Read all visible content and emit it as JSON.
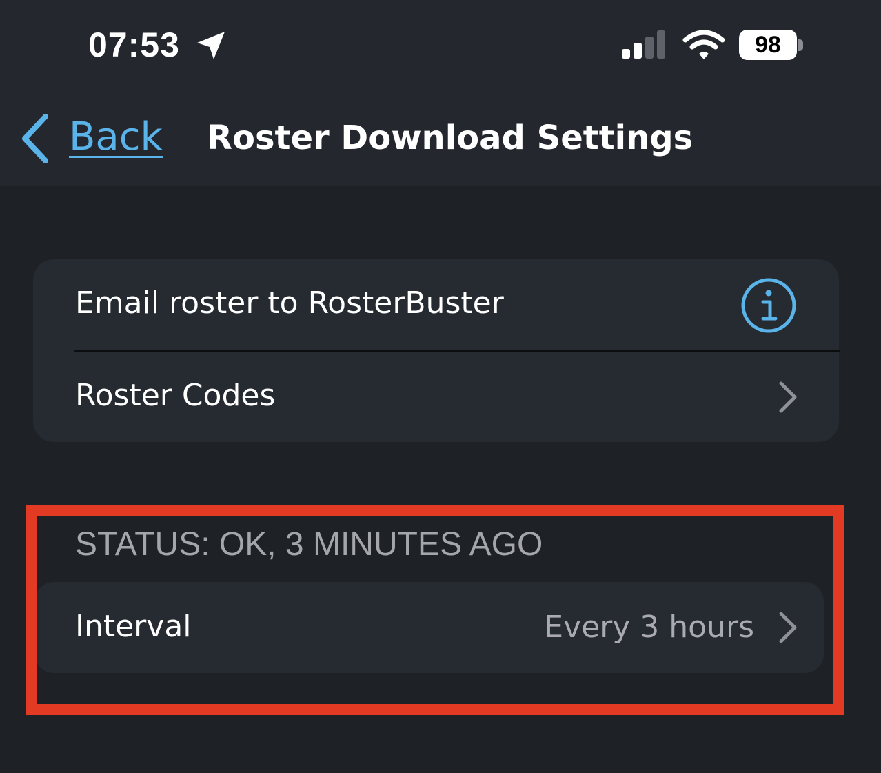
{
  "status_bar": {
    "time": "07:53",
    "battery_level": "98",
    "icons": [
      "location-arrow-icon",
      "cellular-signal-icon",
      "wifi-icon",
      "battery-icon"
    ]
  },
  "nav": {
    "back_label": "Back",
    "title": "Roster Download Settings",
    "accent_color": "#5ab4ea"
  },
  "settings_group": {
    "rows": [
      {
        "label": "Email roster to RosterBuster",
        "accessory": "info-icon"
      },
      {
        "label": "Roster Codes",
        "accessory": "chevron-right-icon"
      }
    ]
  },
  "status_section": {
    "header": "STATUS: OK, 3 MINUTES AGO",
    "interval_label": "Interval",
    "interval_value": "Every 3 hours",
    "highlight_color": "#e33a24"
  }
}
